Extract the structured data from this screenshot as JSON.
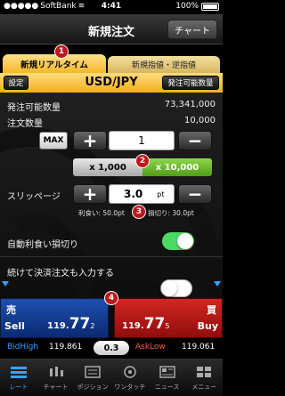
{
  "status_bar": {
    "carrier": "SoftBank",
    "time": "4:41",
    "battery": "100%"
  },
  "nav": {
    "title": "新規注文",
    "chart_button": "チャート"
  },
  "tabs": [
    {
      "label": "新規リアルタイム",
      "active": true
    },
    {
      "label": "新規指値・逆指値",
      "active": false
    }
  ],
  "currency_bar": {
    "settings_button": "設定",
    "pair": "USD/JPY",
    "orderable_button": "発注可能数量"
  },
  "order": {
    "orderable_label": "発注可能数量",
    "orderable_value": "73,341,000",
    "quantity_label": "注文数量",
    "quantity_value": "10,000",
    "max_label": "MAX",
    "quantity_input": "1",
    "mult_1000": "x 1,000",
    "mult_10000": "x 10,000",
    "slippage_label": "スリッページ",
    "slippage_input": "3.0",
    "slippage_unit": "pt",
    "take_profit_text": "利食い: 50.0pt",
    "stop_loss_text": "損切り: 30.0pt",
    "auto_label": "自動利食い損切り",
    "auto_on": true,
    "settle_label": "続けて決済注文も入力する",
    "settle_on": false
  },
  "trade": {
    "sell": {
      "kanji": "売",
      "word": "Sell",
      "price_prefix": "119.",
      "price_big": "77",
      "price_sub": "2"
    },
    "buy": {
      "kanji": "買",
      "word": "Buy",
      "price_prefix": "119.",
      "price_big": "77",
      "price_sub": "5"
    },
    "spread": "0.3",
    "bid_high_label": "BidHigh",
    "bid_high": "119.861",
    "ask_low_label": "AskLow",
    "ask_low": "119.061"
  },
  "tab_bar": [
    {
      "label": "レート",
      "icon": "rate-icon",
      "active": true
    },
    {
      "label": "チャート",
      "icon": "chart-icon",
      "active": false
    },
    {
      "label": "ポジション",
      "icon": "position-icon",
      "active": false
    },
    {
      "label": "ワンタッチ",
      "icon": "one-touch-icon",
      "active": false
    },
    {
      "label": "ニュース",
      "icon": "news-icon",
      "active": false
    },
    {
      "label": "メニュー",
      "icon": "menu-icon",
      "active": false
    }
  ],
  "badges": [
    "1",
    "2",
    "3",
    "4"
  ],
  "colors": {
    "accent_gold": "#f5b728",
    "sell_blue": "#1e4fae",
    "buy_red": "#d42622",
    "toggle_green": "#4cd964"
  }
}
